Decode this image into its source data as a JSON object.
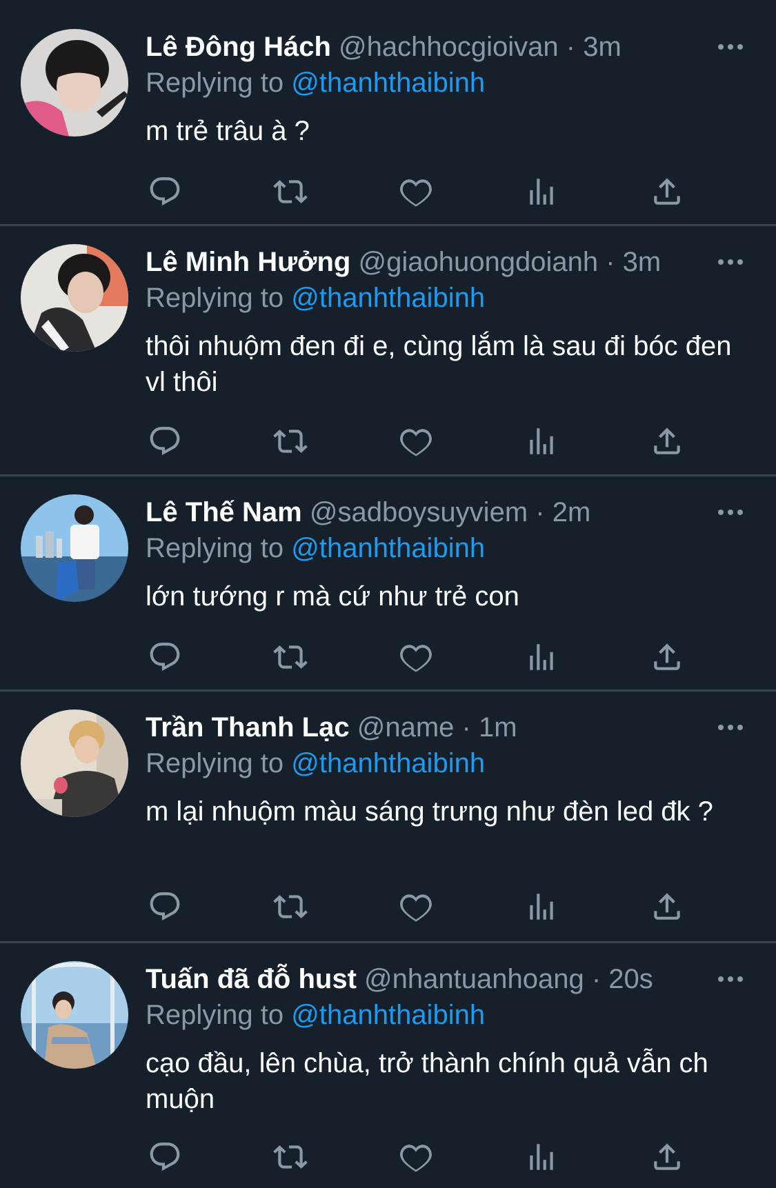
{
  "colors": {
    "background": "#15202b",
    "divider": "#38444d",
    "secondary_text": "#8b98a5",
    "link": "#1d9bf0"
  },
  "replying_prefix": "Replying to",
  "tweets": [
    {
      "name": "Lê Đông Hách",
      "handle": "@hachhocgioivan",
      "time": "3m",
      "replying_to": "@thanhthaibinh",
      "text": "m trẻ trâu à ?"
    },
    {
      "name": "Lê Minh Hưởng",
      "handle": "@giaohuongdoianh",
      "time": "3m",
      "replying_to": "@thanhthaibinh",
      "text": "thôi nhuộm đen đi e, cùng lắm là sau đi bóc đen vl thôi"
    },
    {
      "name": "Lê Thế Nam",
      "handle": "@sadboysuyviem",
      "time": "2m",
      "replying_to": "@thanhthaibinh",
      "text": "lớn tướng r mà cứ như trẻ con"
    },
    {
      "name": "Trần Thanh Lạc",
      "handle": "@name",
      "time": "1m",
      "replying_to": "@thanhthaibinh",
      "text": "m lại nhuộm màu sáng trưng như đèn led đk ?"
    },
    {
      "name": "Tuấn đã đỗ hust",
      "handle": "@nhantuanhoang",
      "time": "20s",
      "replying_to": "@thanhthaibinh",
      "text": "cạo đầu, lên chùa, trở thành chính quả vẫn ch muộn"
    }
  ],
  "icons": [
    "reply-icon",
    "retweet-icon",
    "like-icon",
    "analytics-icon",
    "share-icon",
    "more-icon"
  ]
}
